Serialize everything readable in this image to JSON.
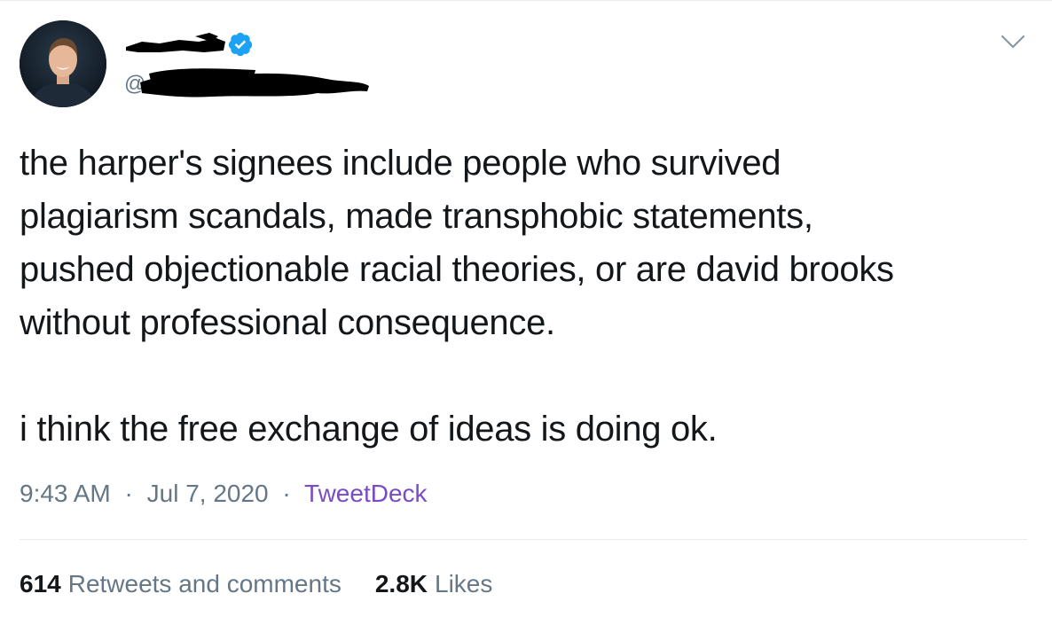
{
  "author": {
    "display_name": "",
    "handle": "@",
    "verified": true,
    "name_redacted": true,
    "handle_redacted": true
  },
  "tweet": {
    "text": "the harper's signees include people who survived\nplagiarism scandals, made transphobic statements,\npushed objectionable racial theories, or are david brooks\nwithout professional consequence.\n\ni think the free exchange of ideas is doing ok."
  },
  "meta": {
    "time": "9:43 AM",
    "separator": "·",
    "date": "Jul 7, 2020",
    "source": "TweetDeck"
  },
  "stats": {
    "retweets_count": "614",
    "retweets_label": "Retweets and comments",
    "likes_count": "2.8K",
    "likes_label": "Likes"
  },
  "icons": {
    "verified": "verified-badge-icon",
    "menu": "chevron-down-icon"
  },
  "colors": {
    "verified_blue": "#1da1f2",
    "secondary_text": "#657786",
    "source_link": "#794bc4",
    "redaction": "#000000"
  }
}
